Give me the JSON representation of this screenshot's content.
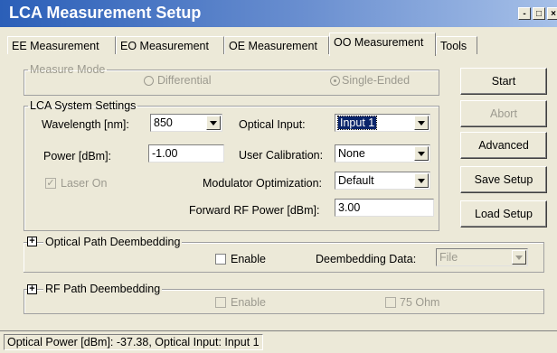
{
  "window": {
    "title": "LCA Measurement Setup",
    "min_label": "-",
    "max_label": "□",
    "close_label": "×"
  },
  "tabs": [
    {
      "label": "EE Measurement"
    },
    {
      "label": "EO Measurement"
    },
    {
      "label": "OE Measurement"
    },
    {
      "label": "OO Measurement",
      "active": true
    },
    {
      "label": "Tools"
    }
  ],
  "measure_mode": {
    "legend": "Measure Mode",
    "differential_label": "Differential",
    "single_ended_label": "Single-Ended",
    "selected": "Single-Ended"
  },
  "lca_settings": {
    "legend": "LCA System Settings",
    "wavelength_label": "Wavelength [nm]:",
    "wavelength_value": "850",
    "power_label": "Power [dBm]:",
    "power_value": "-1.00",
    "laser_on_label": "Laser On",
    "laser_on_checked": true,
    "optical_input_label": "Optical Input:",
    "optical_input_value": "Input 1",
    "user_cal_label": "User Calibration:",
    "user_cal_value": "None",
    "mod_opt_label": "Modulator Optimization:",
    "mod_opt_value": "Default",
    "fwd_rf_label": "Forward RF Power [dBm]:",
    "fwd_rf_value": "3.00"
  },
  "buttons": {
    "start": "Start",
    "abort": "Abort",
    "advanced": "Advanced",
    "save_setup": "Save Setup",
    "load_setup": "Load Setup"
  },
  "optical_deembed": {
    "legend": "Optical Path Deembedding",
    "expander": "+",
    "enable_label": "Enable",
    "data_label": "Deembedding Data:",
    "data_value": "File"
  },
  "rf_deembed": {
    "legend": "RF Path Deembedding",
    "expander": "+",
    "enable_label": "Enable",
    "ohm_label": "75 Ohm"
  },
  "status": {
    "text": "Optical Power [dBm]: -37.38,  Optical Input: Input 1"
  }
}
